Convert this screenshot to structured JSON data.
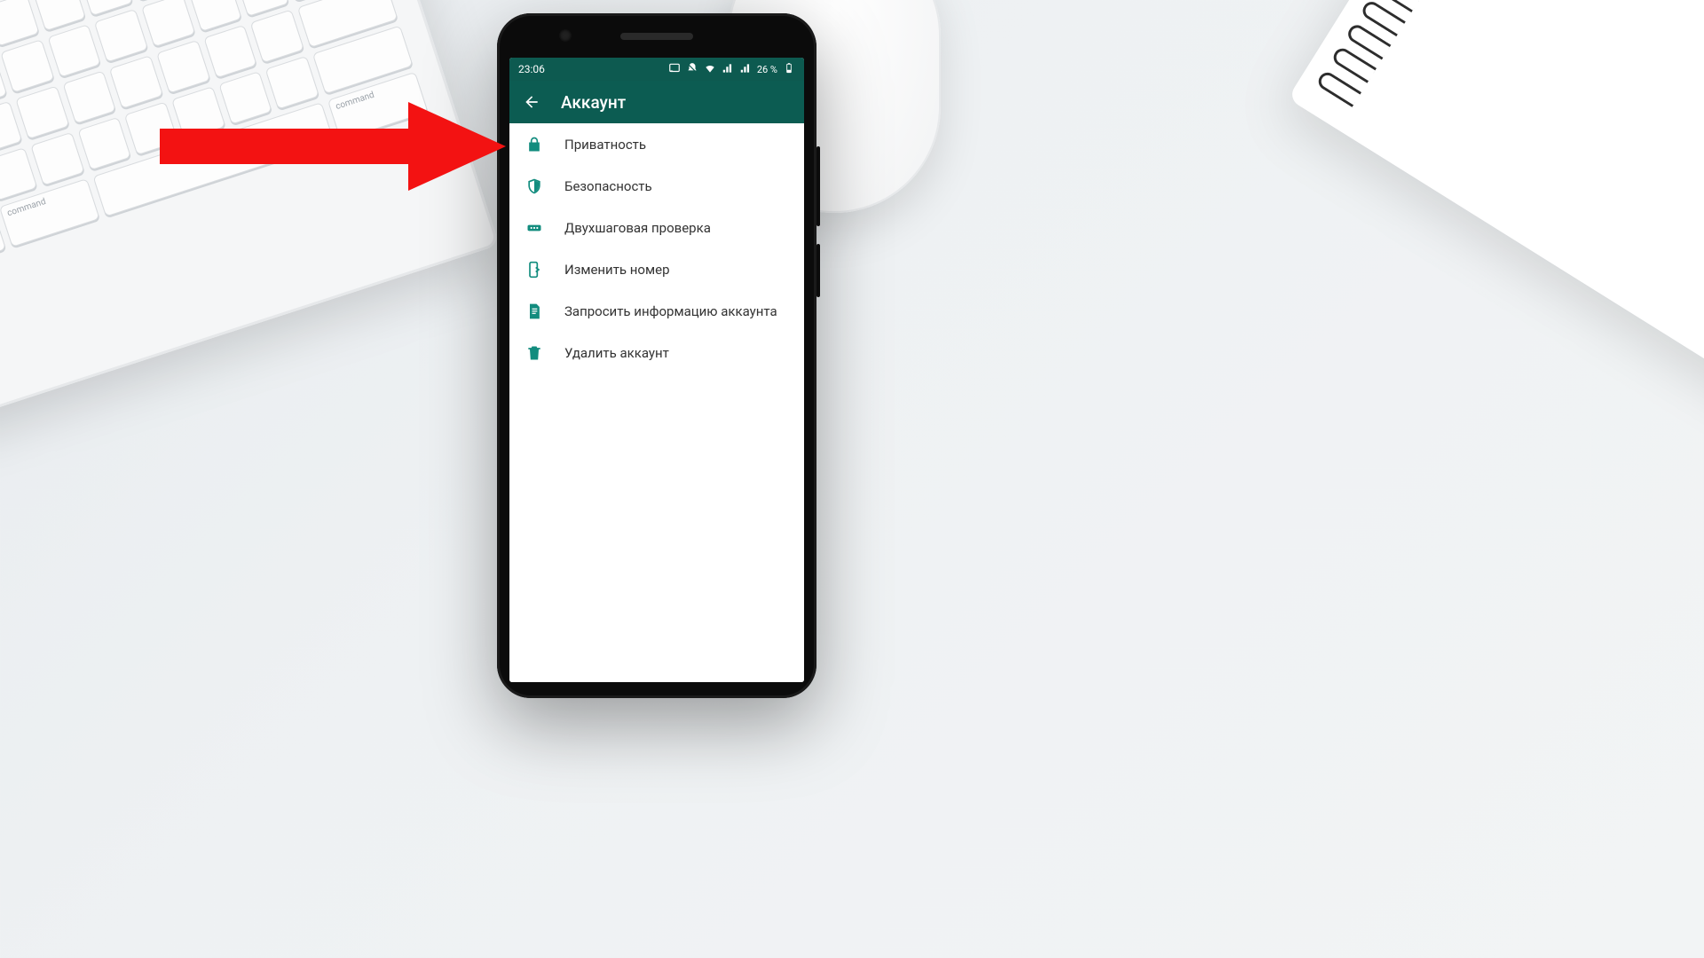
{
  "statusbar": {
    "time": "23:06",
    "battery": "26 %"
  },
  "appbar": {
    "title": "Аккаунт"
  },
  "menu": {
    "items": [
      {
        "icon": "lock-icon",
        "label": "Приватность"
      },
      {
        "icon": "shield-icon",
        "label": "Безопасность"
      },
      {
        "icon": "dots-icon",
        "label": "Двухшаговая проверка"
      },
      {
        "icon": "phone-change-icon",
        "label": "Изменить номер"
      },
      {
        "icon": "document-icon",
        "label": "Запросить информацию аккаунта"
      },
      {
        "icon": "trash-icon",
        "label": "Удалить аккаунт"
      }
    ]
  },
  "colors": {
    "appbar": "#0c5c52",
    "icon": "#128c7e",
    "arrow": "#f31212"
  }
}
